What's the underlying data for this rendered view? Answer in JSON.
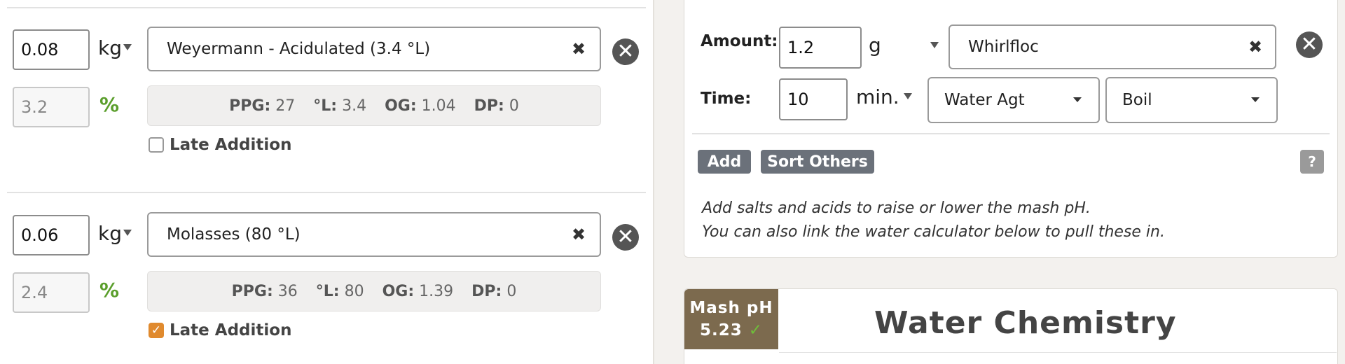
{
  "fermentables": [
    {
      "amount": "0.08",
      "unit": "kg",
      "name": "Weyermann - Acidulated (3.4 °L)",
      "percent": "3.2",
      "percent_symbol": "%",
      "stats": {
        "ppg_label": "PPG:",
        "ppg": "27",
        "l_label": "°L:",
        "l": "3.4",
        "og_label": "OG:",
        "og": "1.04",
        "dp_label": "DP:",
        "dp": "0"
      },
      "late_addition_label": "Late Addition",
      "late_addition_checked": false
    },
    {
      "amount": "0.06",
      "unit": "kg",
      "name": "Molasses (80 °L)",
      "percent": "2.4",
      "percent_symbol": "%",
      "stats": {
        "ppg_label": "PPG:",
        "ppg": "36",
        "l_label": "°L:",
        "l": "80",
        "og_label": "OG:",
        "og": "1.39",
        "dp_label": "DP:",
        "dp": "0"
      },
      "late_addition_label": "Late Addition",
      "late_addition_checked": true
    }
  ],
  "others": {
    "amount_label": "Amount:",
    "amount": "1.2",
    "amount_unit": "g",
    "ingredient": "Whirlfloc",
    "time_label": "Time:",
    "time": "10",
    "time_unit": "min.",
    "use_select": "Water Agt",
    "stage_select": "Boil",
    "add_button": "Add",
    "sort_button": "Sort Others",
    "help_button": "?",
    "hint_line1": "Add salts and acids to raise or lower the mash pH.",
    "hint_line2": "You can also link the water calculator below to pull these in."
  },
  "water": {
    "mash_ph_label": "Mash pH",
    "mash_ph_value": "5.23",
    "ok_mark": "✓",
    "title": "Water Chemistry"
  },
  "icons": {
    "clear": "✖",
    "remove": "✕",
    "check": "✓"
  },
  "colors": {
    "percent_green": "#5a9e2b",
    "checkbox_orange": "#e08a2e",
    "badge_brown": "#7c6a4e",
    "button_gray": "#6b717a"
  }
}
